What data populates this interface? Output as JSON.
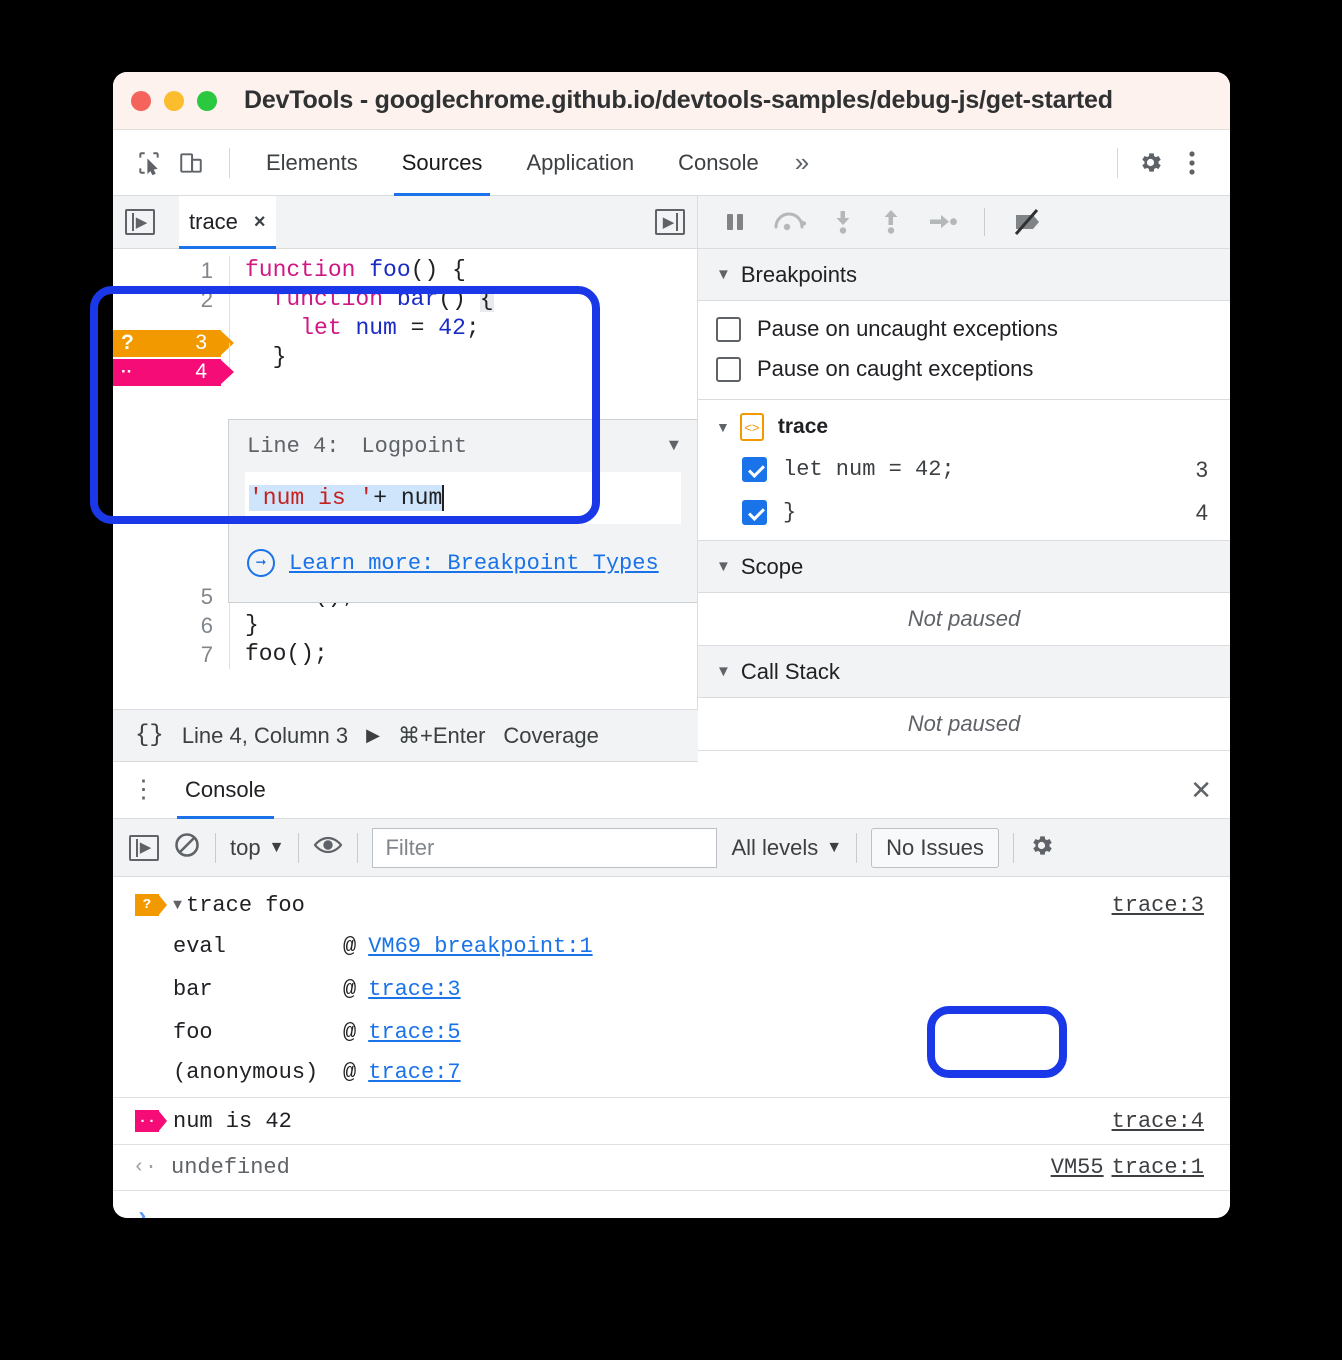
{
  "window": {
    "title": "DevTools - googlechrome.github.io/devtools-samples/debug-js/get-started",
    "traffic_lights": [
      "close",
      "minimize",
      "zoom"
    ]
  },
  "devtools_tabbar": {
    "inspect_icon": "inspect-cursor-icon",
    "device_icon": "device-toolbar-icon",
    "tabs": [
      {
        "label": "Elements",
        "active": false
      },
      {
        "label": "Sources",
        "active": true
      },
      {
        "label": "Application",
        "active": false
      },
      {
        "label": "Console",
        "active": false
      }
    ],
    "more_tabs": "»",
    "settings_icon": "gear-icon",
    "menu_icon": "kebab-menu-icon"
  },
  "editor": {
    "navigator_toggle_icon": "show-navigator-icon",
    "debugger_toggle_icon": "show-debugger-icon",
    "file_tab": {
      "name": "trace",
      "close": "×"
    },
    "lines": [
      {
        "n": "1",
        "tokens": [
          {
            "t": "function ",
            "c": "kw"
          },
          {
            "t": "foo",
            "c": "id"
          },
          {
            "t": "() {",
            "c": ""
          }
        ]
      },
      {
        "n": "2",
        "tokens": [
          {
            "t": "  function ",
            "c": "kw"
          },
          {
            "t": "bar",
            "c": "id"
          },
          {
            "t": "() ",
            "c": ""
          },
          {
            "t": "{",
            "c": "brace-hl"
          }
        ]
      },
      {
        "n": "3",
        "tokens": [
          {
            "t": "    let ",
            "c": "kw"
          },
          {
            "t": "num",
            "c": "id"
          },
          {
            "t": " = ",
            "c": ""
          },
          {
            "t": "42",
            "c": "num"
          },
          {
            "t": ";",
            "c": ""
          }
        ]
      },
      {
        "n": "4",
        "tokens": [
          {
            "t": "  }",
            "c": ""
          }
        ]
      },
      {
        "n": "5",
        "tokens": [
          {
            "t": "  bar();",
            "c": ""
          }
        ]
      },
      {
        "n": "6",
        "tokens": [
          {
            "t": "}",
            "c": ""
          }
        ]
      },
      {
        "n": "7",
        "tokens": [
          {
            "t": "foo();",
            "c": ""
          }
        ]
      }
    ],
    "gutter_markers": [
      {
        "line": "3",
        "kind": "conditional",
        "mark": "?",
        "color": "#f29900"
      },
      {
        "line": "4",
        "kind": "logpoint",
        "mark": "․․",
        "color": "#f50c77"
      }
    ]
  },
  "logpoint_popup": {
    "line_label": "Line 4:",
    "type_value": "Logpoint",
    "caret_icon": "chevron-down-icon",
    "expression_selected": "'num is '",
    "expression_rest": " + num",
    "link_icon": "arrow-right-circle-icon",
    "link_text": "Learn more: Breakpoint Types"
  },
  "status_bar": {
    "format_icon": "{}",
    "position": "Line 4, Column 3",
    "run_icon": "▶",
    "shortcut": "⌘+Enter",
    "coverage": "Coverage"
  },
  "debugger": {
    "toolbar": [
      {
        "name": "resume-pause-icon",
        "title": "Pause script execution"
      },
      {
        "name": "step-over-icon",
        "title": "Step over next function call"
      },
      {
        "name": "step-into-icon",
        "title": "Step into next function call"
      },
      {
        "name": "step-out-icon",
        "title": "Step out of current function"
      },
      {
        "name": "step-icon",
        "title": "Step"
      },
      {
        "name": "deactivate-breakpoints-icon",
        "title": "Deactivate breakpoints"
      }
    ],
    "breakpoints_header": "Breakpoints",
    "options": [
      {
        "label": "Pause on uncaught exceptions",
        "checked": false
      },
      {
        "label": "Pause on caught exceptions",
        "checked": false
      }
    ],
    "file_group": {
      "name": "trace",
      "file_icon": "source-file-icon",
      "items": [
        {
          "code": "let num = 42;",
          "line": "3",
          "checked": true
        },
        {
          "code": "}",
          "line": "4",
          "checked": true
        }
      ]
    },
    "scope_header": "Scope",
    "scope_value": "Not paused",
    "callstack_header": "Call Stack",
    "callstack_value": "Not paused"
  },
  "drawer": {
    "menu_icon": "kebab-menu-icon",
    "tab_label": "Console",
    "close_icon": "close-icon",
    "toolbar": {
      "sidebar_icon": "console-sidebar-icon",
      "clear_icon": "clear-console-icon",
      "context": "top",
      "eye_icon": "live-expression-icon",
      "filter_placeholder": "Filter",
      "filter_value": "",
      "levels": "All levels",
      "issues": "No Issues",
      "settings_icon": "gear-icon"
    },
    "messages": [
      {
        "kind": "trace",
        "badge": "warn",
        "disclosure": "▼",
        "text": "trace foo",
        "source": "trace:3",
        "stack": [
          {
            "fn": "eval",
            "at": "@",
            "link": "VM69 breakpoint:1"
          },
          {
            "fn": "bar",
            "at": "@",
            "link": "trace:3"
          },
          {
            "fn": "foo",
            "at": "@",
            "link": "trace:5"
          },
          {
            "fn": "(anonymous)",
            "at": "@",
            "link": "trace:7"
          }
        ]
      },
      {
        "kind": "log",
        "badge": "log",
        "text": "num is 42",
        "source": "trace:4"
      },
      {
        "kind": "result",
        "arrow": "‹·",
        "text": "undefined",
        "source_prefix": "VM55",
        "source": "trace:1"
      }
    ],
    "prompt": "›"
  },
  "annotations": [
    {
      "name": "logpoint-popup-highlight",
      "color": "#1a38e8"
    },
    {
      "name": "trace4-source-highlight",
      "color": "#1a38e8"
    }
  ]
}
